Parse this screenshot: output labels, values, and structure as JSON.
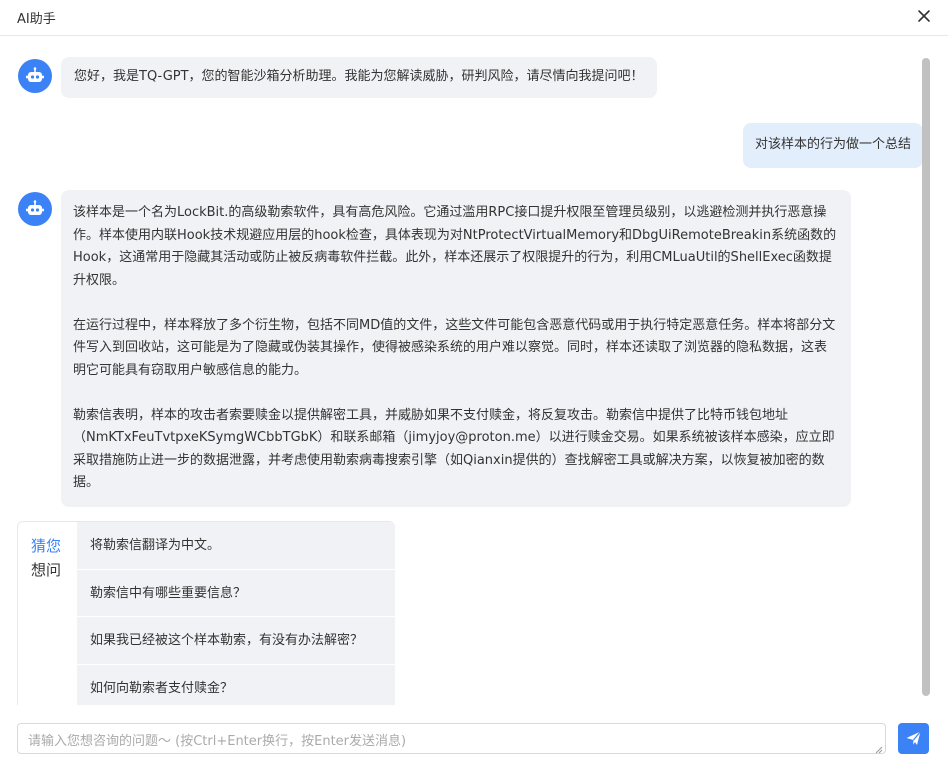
{
  "window": {
    "title": "AI助手"
  },
  "icons": {
    "close": "close-icon",
    "robot": "robot-icon",
    "send": "send-icon"
  },
  "colors": {
    "accent": "#3b82f6",
    "bot_bubble": "#f0f2f5",
    "user_bubble": "#e3eefc"
  },
  "messages": [
    {
      "role": "assistant",
      "paragraphs": [
        "您好，我是TQ-GPT，您的智能沙箱分析助理。我能为您解读威胁，研判风险，请尽情向我提问吧！"
      ]
    },
    {
      "role": "user",
      "text": "对该样本的行为做一个总结"
    },
    {
      "role": "assistant",
      "paragraphs": [
        "该样本是一个名为LockBit.的高级勒索软件，具有高危风险。它通过滥用RPC接口提升权限至管理员级别，以逃避检测并执行恶意操作。样本使用内联Hook技术规避应用层的hook检查，具体表现为对NtProtectVirtualMemory和DbgUiRemoteBreakin系统函数的Hook，这通常用于隐藏其活动或防止被反病毒软件拦截。此外，样本还展示了权限提升的行为，利用CMLuaUtil的ShellExec函数提升权限。",
        "在运行过程中，样本释放了多个衍生物，包括不同MD值的文件，这些文件可能包含恶意代码或用于执行特定恶意任务。样本将部分文件写入到回收站，这可能是为了隐藏或伪装其操作，使得被感染系统的用户难以察觉。同时，样本还读取了浏览器的隐私数据，这表明它可能具有窃取用户敏感信息的能力。",
        "勒索信表明，样本的攻击者索要赎金以提供解密工具，并威胁如果不支付赎金，将反复攻击。勒索信中提供了比特币钱包地址（NmKTxFeuTvtpxeKSymgWCbbTGbK）和联系邮箱（jimyjoy@proton.me）以进行赎金交易。如果系统被该样本感染，应立即采取措施防止进一步的数据泄露，并考虑使用勒索病毒搜索引擎（如Qianxin提供的）查找解密工具或解决方案，以恢复被加密的数据。"
      ]
    }
  ],
  "suggestions": {
    "label_line1": "猜您",
    "label_line2": "想问",
    "items": [
      "将勒索信翻译为中文。",
      "勒索信中有哪些重要信息？",
      "如果我已经被这个样本勒索，有没有办法解密？",
      "如何向勒索者支付赎金？"
    ]
  },
  "composer": {
    "placeholder": "请输入您想咨询的问题～ (按Ctrl+Enter换行，按Enter发送消息)",
    "value": ""
  }
}
